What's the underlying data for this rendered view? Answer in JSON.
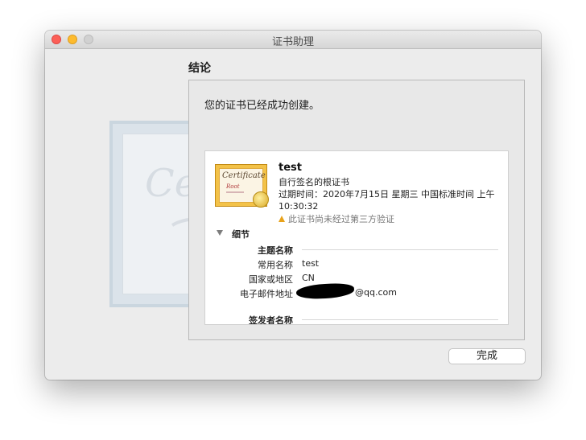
{
  "window": {
    "title": "证书助理"
  },
  "section": {
    "title": "结论"
  },
  "message": "您的证书已经成功创建。",
  "certificate": {
    "icon_text": "Certificate",
    "icon_root_text": "Root",
    "name": "test",
    "type": "自行签名的根证书",
    "expiry": "过期时间：2020年7月15日 星期三 中国标准时间 上午10:30:32",
    "warning": "此证书尚未经过第三方验证",
    "warning_icon": "warning-triangle-icon"
  },
  "details": {
    "label": "细节",
    "subject_name_label": "主题名称",
    "common_name_label": "常用名称",
    "common_name_value": "test",
    "country_label": "国家或地区",
    "country_value": "CN",
    "email_label": "电子邮件地址",
    "email_value": "@qq.com",
    "issuer_name_label": "签发者名称"
  },
  "buttons": {
    "done": "完成"
  },
  "colors": {
    "close": "#fc5f57",
    "minimize": "#fdbb2e",
    "zoom": "#d1d1d1",
    "warning": "#e8a21a"
  }
}
